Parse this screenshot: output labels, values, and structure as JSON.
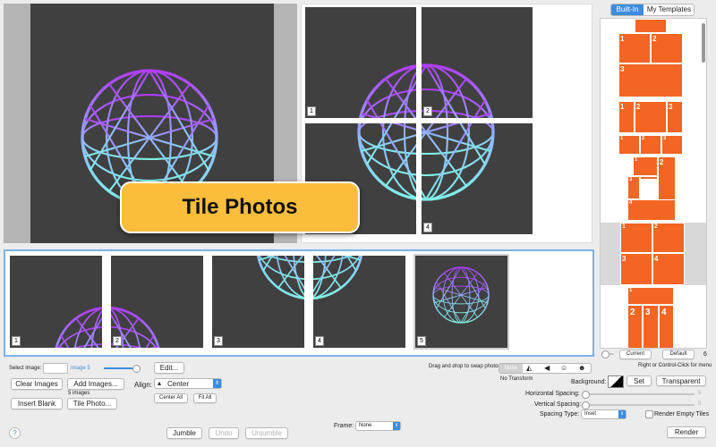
{
  "overlay": {
    "title": "Tile Photos"
  },
  "tiles": {
    "labels": [
      "1",
      "2",
      "3",
      "4"
    ]
  },
  "thumbnails": {
    "labels": [
      "1",
      "2",
      "3",
      "4",
      "5"
    ]
  },
  "templates": {
    "tabs": [
      "Built-In",
      "My Templates"
    ],
    "current_label": "Current",
    "default_label": "Default",
    "count": "6"
  },
  "controls": {
    "select_image_label": "Select image:",
    "image_index": "Image 5",
    "edit_button": "Edit...",
    "clear_images": "Clear Images",
    "add_images": "Add Images...",
    "image_count": "5 images",
    "align_label": "Align:",
    "align_value": "Center",
    "center_all": "Center All",
    "fit_all": "Fit All",
    "insert_blank": "Insert Blank",
    "tile_photo": "Tile Photo...",
    "drag_hint": "Drag and drop to swap photos",
    "transform_none": "None",
    "no_transform": "No Transform",
    "right_click_hint": "Right or Control-Click for menu",
    "background_label": "Background:",
    "set_button": "Set",
    "transparent_button": "Transparent",
    "horizontal_spacing": "Horizontal Spacing:",
    "vertical_spacing": "Vertical Spacing:",
    "h_spacing_value": "5",
    "v_spacing_value": "5",
    "spacing_type_label": "Spacing Type:",
    "spacing_type_value": "Inset",
    "render_empty_tiles": "Render Empty Tiles",
    "frame_label": "Frame:",
    "frame_value": "None",
    "jumble": "Jumble",
    "undo": "Undo",
    "unjumble": "Unjumble",
    "render": "Render",
    "help": "?"
  },
  "colors": {
    "accent": "#f26522",
    "selection": "#3b8de0",
    "tile_bg": "#404040",
    "callout": "#fbbd3c"
  }
}
